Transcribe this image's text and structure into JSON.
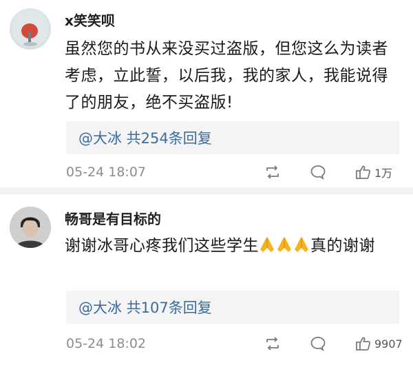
{
  "comments": [
    {
      "username": "x笑笑呗",
      "text": "虽然您的书从来没买过盗版，但您这么为读者考虑，立此誓，以后我，我的家人，我能说得了的朋友，绝不买盗版!",
      "reply_link": "@大冰 共254条回复",
      "timestamp": "05-24 18:07",
      "like_count": "1万"
    },
    {
      "username": "畅哥是有目标的",
      "text_before_emoji": "谢谢冰哥心疼我们这些学生",
      "emoji_name": "folded-hands-icon",
      "emoji_count": 3,
      "text_after_emoji": "真的谢谢",
      "reply_link": "@大冰 共107条回复",
      "timestamp": "05-24 18:02",
      "like_count": "9907"
    }
  ],
  "colors": {
    "link": "#3c6b9c",
    "meta_gray": "#8c8c8c",
    "reply_bg": "#f4f4f4",
    "divider": "#f2f2f2",
    "emoji": "#f5b41e"
  }
}
